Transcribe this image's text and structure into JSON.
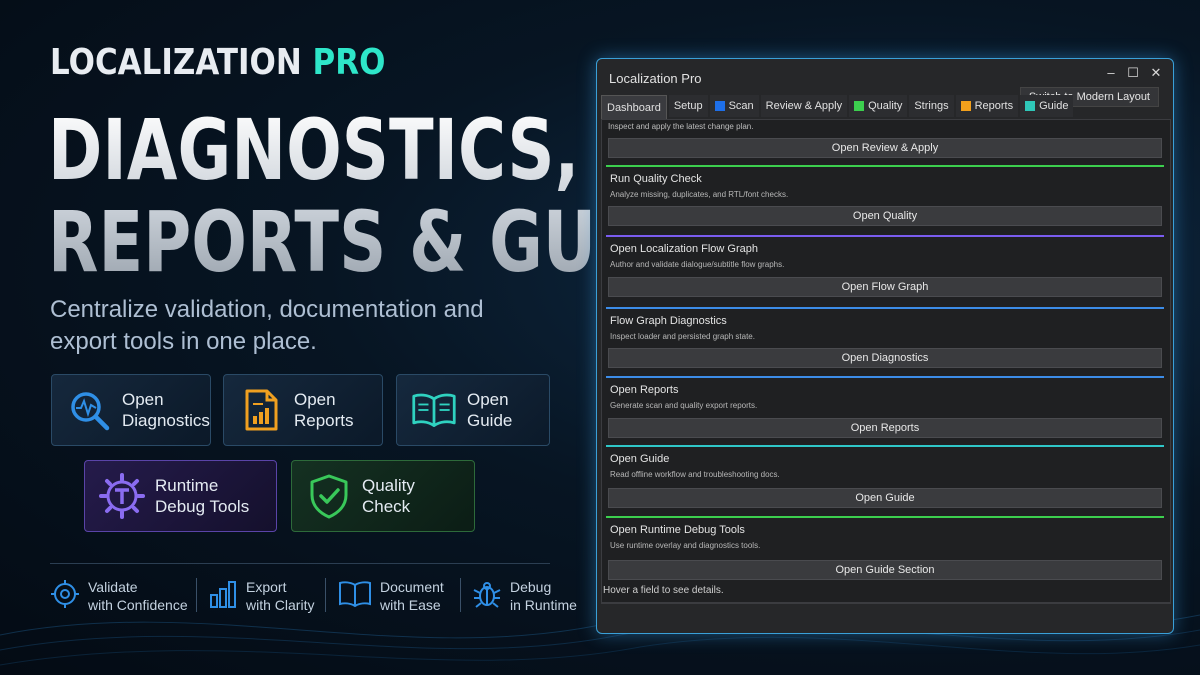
{
  "brand": {
    "name": "LOCALIZATION",
    "suffix": "PRO"
  },
  "headline": {
    "line1": "DIAGNOSTICS,",
    "line2": "REPORTS & GUIDE"
  },
  "subtitle": "Centralize validation, documentation and export tools in one place.",
  "tiles": [
    {
      "label": "Open\nDiagnostics",
      "icon": "magnifier-pulse-icon",
      "color": "#2f8fe6"
    },
    {
      "label": "Open\nReports",
      "icon": "report-document-icon",
      "color": "#f0a020"
    },
    {
      "label": "Open\nGuide",
      "icon": "open-book-icon",
      "color": "#2fd2c0"
    },
    {
      "label": "Runtime\nDebug Tools",
      "icon": "gear-t-icon",
      "color": "#8a6cf0"
    },
    {
      "label": "Quality\nCheck",
      "icon": "shield-check-icon",
      "color": "#39c85a"
    }
  ],
  "features": [
    {
      "label": "Validate\nwith Confidence",
      "icon": "target-icon"
    },
    {
      "label": "Export\nwith Clarity",
      "icon": "bar-chart-icon"
    },
    {
      "label": "Document\nwith Ease",
      "icon": "book-icon"
    },
    {
      "label": "Debug\nin Runtime",
      "icon": "bug-icon"
    }
  ],
  "window": {
    "title": "Localization Pro",
    "controls": {
      "minimize": "–",
      "maximize": "☐",
      "close": "✕"
    },
    "tabs": [
      {
        "label": "Dashboard",
        "color": ""
      },
      {
        "label": "Setup",
        "color": ""
      },
      {
        "label": "Scan",
        "color": "#1e6fe8"
      },
      {
        "label": "Review & Apply",
        "color": ""
      },
      {
        "label": "Quality",
        "color": "#3ccf4e"
      },
      {
        "label": "Strings",
        "color": ""
      },
      {
        "label": "Reports",
        "color": "#f2a01c"
      },
      {
        "label": "Guide",
        "color": "#2fc7b8"
      }
    ],
    "modern_layout_button": "Switch to Modern Layout",
    "top_note": "Inspect and apply the latest change plan.",
    "top_button": "Open Review & Apply",
    "sections": [
      {
        "title": "Run Quality Check",
        "desc": "Analyze missing, duplicates, and RTL/font checks.",
        "button": "Open Quality",
        "color": "#3ccf4e"
      },
      {
        "title": "Open Localization Flow Graph",
        "desc": "Author and validate dialogue/subtitle flow graphs.",
        "button": "Open Flow Graph",
        "color": "#7a5cf0"
      },
      {
        "title": "Flow Graph Diagnostics",
        "desc": "Inspect loader and persisted graph state.",
        "button": "Open Diagnostics",
        "color": "#3c8ce8"
      },
      {
        "title": "Open Reports",
        "desc": "Generate scan and quality export reports.",
        "button": "Open Reports",
        "color": "#3c8ce8"
      },
      {
        "title": "Open Guide",
        "desc": "Read offline workflow and troubleshooting docs.",
        "button": "Open Guide",
        "color": "#2fc7c8"
      },
      {
        "title": "Open Runtime Debug Tools",
        "desc": "Use runtime overlay and diagnostics tools.",
        "button": "Open Guide Section",
        "color": "#3ccf4e"
      }
    ],
    "status": "Hover a field to see details."
  }
}
